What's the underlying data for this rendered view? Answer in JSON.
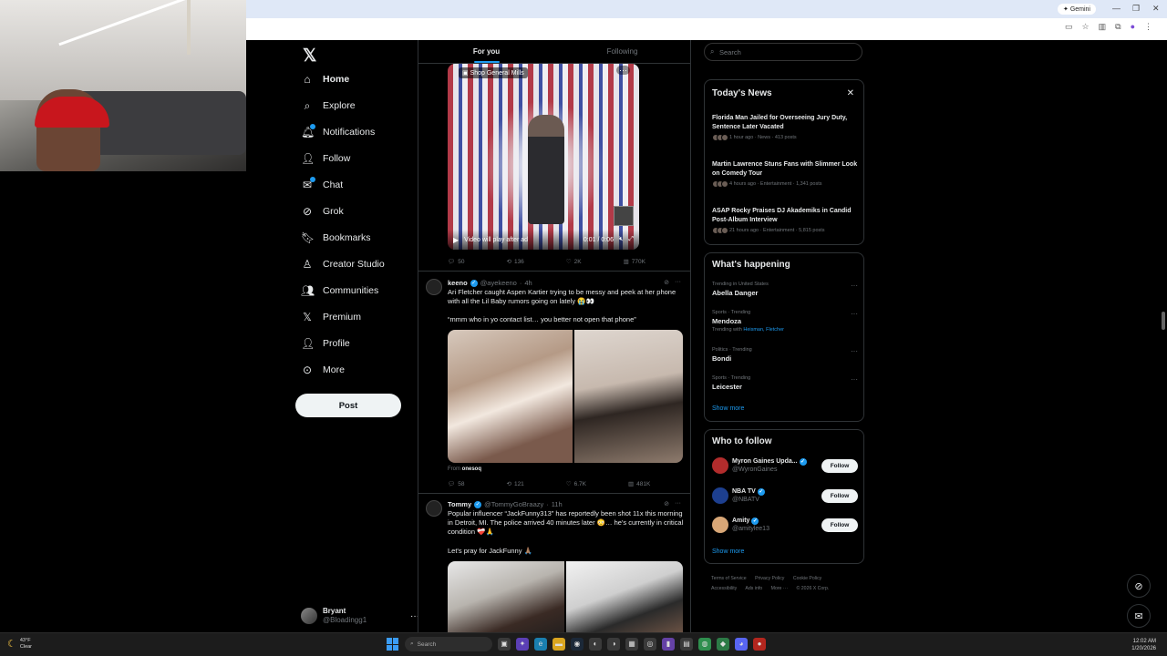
{
  "browser": {
    "gemini_label": "Gemini"
  },
  "nav": {
    "items": [
      {
        "label": "Home",
        "icon": "home-icon"
      },
      {
        "label": "Explore",
        "icon": "search-icon"
      },
      {
        "label": "Notifications",
        "icon": "bell-icon"
      },
      {
        "label": "Follow",
        "icon": "person-add-icon"
      },
      {
        "label": "Chat",
        "icon": "mail-icon"
      },
      {
        "label": "Grok",
        "icon": "grok-icon"
      },
      {
        "label": "Bookmarks",
        "icon": "bookmark-icon"
      },
      {
        "label": "Creator Studio",
        "icon": "creator-icon"
      },
      {
        "label": "Communities",
        "icon": "people-icon"
      },
      {
        "label": "Premium",
        "icon": "x-icon"
      },
      {
        "label": "Profile",
        "icon": "person-icon"
      },
      {
        "label": "More",
        "icon": "more-circle-icon"
      }
    ],
    "post_label": "Post",
    "account": {
      "name": "Bryant",
      "handle": "@Bloadingg1"
    }
  },
  "feed": {
    "tabs": [
      "For you",
      "Following"
    ],
    "video": {
      "shop_label": "Shop General Mills",
      "overlay_text": "Video will play after ad",
      "time": "0:01 / 0:06"
    },
    "post1_stats": {
      "replies": "50",
      "reposts": "136",
      "likes": "2K",
      "views": "770K"
    },
    "post2": {
      "name": "keeno",
      "handle": "@ayekeeno",
      "time": "4h",
      "text1": "Ari Fletcher caught Aspen Kartier trying to be messy and peek at her phone with all the Lil Baby rumors going on lately 😭👀",
      "text2": "“mmm who in yo contact list… you better not open that phone”",
      "from_label": "From",
      "from_source": "onesoq",
      "stats": {
        "replies": "58",
        "reposts": "121",
        "likes": "6.7K",
        "views": "481K"
      }
    },
    "post3": {
      "name": "Tommy",
      "handle": "@TommyGoBraazy",
      "time": "11h",
      "text1": "Popular influencer “JackFunny313” has reportedly been shot 11x this morning in Detroit, MI. The police arrived 40 minutes later 😳… he's currently in critical condition ❤️‍🩹🙏",
      "text2": "Let's pray for JackFunny 🙏🏽"
    }
  },
  "sidebar": {
    "search_placeholder": "Search",
    "todays_news": {
      "title": "Today's News",
      "items": [
        {
          "headline": "Florida Man Jailed for Overseeing Jury Duty, Sentence Later Vacated",
          "meta": "1 hour ago · News · 413 posts"
        },
        {
          "headline": "Martin Lawrence Stuns Fans with Slimmer Look on Comedy Tour",
          "meta": "4 hours ago · Entertainment · 1,341 posts"
        },
        {
          "headline": "ASAP Rocky Praises DJ Akademiks in Candid Post-Album Interview",
          "meta": "21 hours ago · Entertainment · 5,815 posts"
        }
      ]
    },
    "happening": {
      "title": "What's happening",
      "trends": [
        {
          "meta": "Trending in United States",
          "name": "Abella Danger",
          "with": ""
        },
        {
          "meta": "Sports · Trending",
          "name": "Mendoza",
          "with": "Heisman, Fletcher"
        },
        {
          "meta": "Politics · Trending",
          "name": "Bondi",
          "with": ""
        },
        {
          "meta": "Sports · Trending",
          "name": "Leicester",
          "with": ""
        }
      ],
      "with_prefix": "Trending with",
      "show_more": "Show more"
    },
    "who_to_follow": {
      "title": "Who to follow",
      "accounts": [
        {
          "name": "Myron Gaines Upda...",
          "handle": "@WyronGaines"
        },
        {
          "name": "NBA TV",
          "handle": "@NBATV"
        },
        {
          "name": "Amity",
          "handle": "@amitylee13"
        }
      ],
      "follow_label": "Follow",
      "show_more": "Show more"
    },
    "footer": [
      "Terms of Service",
      "Privacy Policy",
      "Cookie Policy",
      "Accessibility",
      "Ads info",
      "More ···",
      "© 2026 X Corp."
    ]
  },
  "taskbar": {
    "weather_temp": "43°F",
    "weather_cond": "Clear",
    "search_label": "Search",
    "time": "12:02 AM",
    "date": "1/20/2026"
  }
}
